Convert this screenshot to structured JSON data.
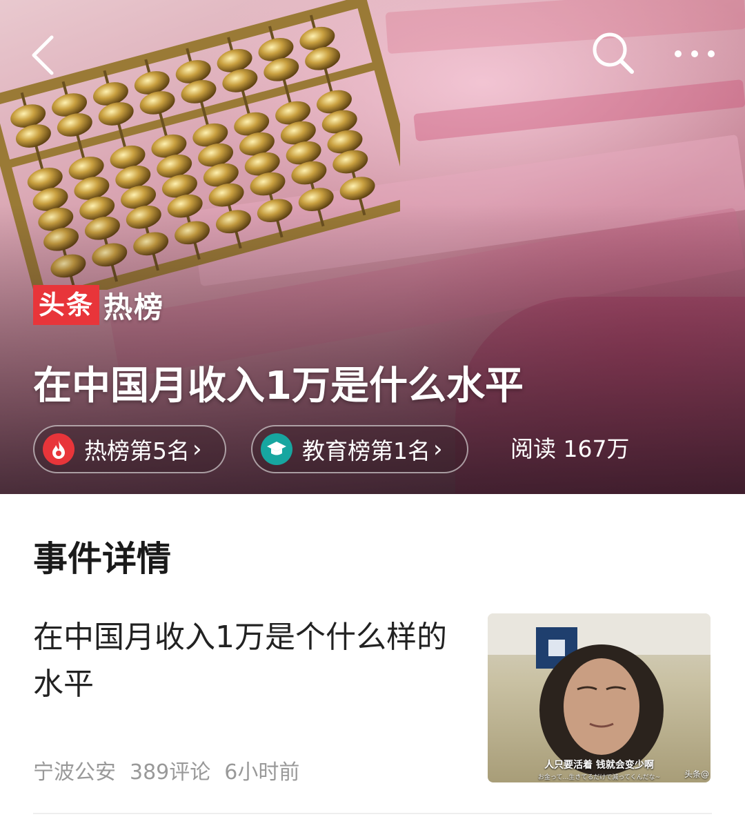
{
  "header": {
    "back_icon": "chevron-left-icon",
    "search_icon": "search-icon",
    "more_icon": "more-horizontal-icon"
  },
  "hero": {
    "brand_box": "头条",
    "brand_text": "热榜",
    "title": "在中国月收入1万是什么水平",
    "chips": [
      {
        "label": "热榜第5名",
        "icon": "flame-icon",
        "color": "#e8353a"
      },
      {
        "label": "教育榜第1名",
        "icon": "graduation-cap-icon",
        "color": "#17a6a0"
      }
    ],
    "reads": "阅读 167万"
  },
  "section": {
    "title": "事件详情"
  },
  "article": {
    "title": "在中国月收入1万是个什么样的水平",
    "source": "宁波公安",
    "comments": "389评论",
    "time": "6小时前",
    "thumb_caption": "人只要活着 钱就会变少啊",
    "thumb_caption_jp": "お金って…生きてるだけで減ってくんだな~",
    "thumb_watermark": "头条@"
  },
  "colors": {
    "brand_red": "#e8353a",
    "edu_teal": "#17a6a0"
  }
}
